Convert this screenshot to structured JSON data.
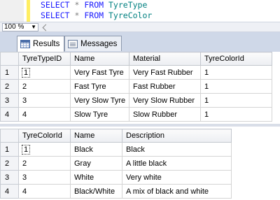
{
  "editor": {
    "lines": [
      {
        "kw1": "SELECT",
        "op": "*",
        "kw2": "FROM",
        "table": "TyreType"
      },
      {
        "kw1": "SELECT",
        "op": "*",
        "kw2": "FROM",
        "table": "TyreColor"
      }
    ]
  },
  "zoom": {
    "value": "100 %"
  },
  "tabs": {
    "results_label": "Results",
    "messages_label": "Messages"
  },
  "grid1": {
    "columns": [
      "TyreTypeID",
      "Name",
      "Material",
      "TyreColorId"
    ],
    "rows": [
      {
        "num": "1",
        "cells": [
          "1",
          "Very Fast Tyre",
          "Very Fast Rubber",
          "1"
        ]
      },
      {
        "num": "2",
        "cells": [
          "2",
          "Fast Tyre",
          "Fast Rubber",
          "1"
        ]
      },
      {
        "num": "3",
        "cells": [
          "3",
          "Very Slow Tyre",
          "Very Slow Rubber",
          "1"
        ]
      },
      {
        "num": "4",
        "cells": [
          "4",
          "Slow Tyre",
          "Slow Rubber",
          "1"
        ]
      }
    ]
  },
  "grid2": {
    "columns": [
      "TyreColorId",
      "Name",
      "Description"
    ],
    "rows": [
      {
        "num": "1",
        "cells": [
          "1",
          "Black",
          "Black"
        ]
      },
      {
        "num": "2",
        "cells": [
          "2",
          "Gray",
          "A little black"
        ]
      },
      {
        "num": "3",
        "cells": [
          "3",
          "White",
          "Very white"
        ]
      },
      {
        "num": "4",
        "cells": [
          "4",
          "Black/White",
          "A mix of black and white"
        ]
      }
    ]
  },
  "colors": {
    "keyword": "#1a1aff",
    "table_name": "#008080",
    "highlight_bar": "#ffee62"
  }
}
